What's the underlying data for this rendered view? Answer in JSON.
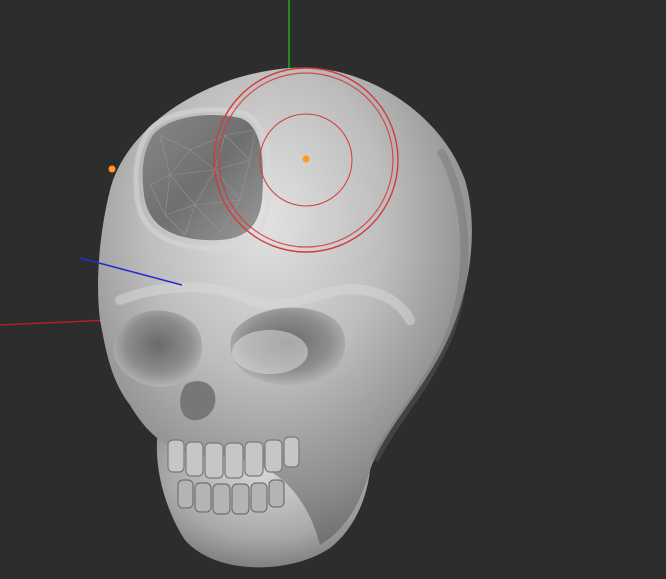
{
  "viewport": {
    "background": "#2d2d2d",
    "model_name": "skull-mesh",
    "tool": "sculpt-brush"
  },
  "colors": {
    "axis_x": "#b22222",
    "axis_y": "#22aa22",
    "axis_z": "#2a2ad0",
    "brush_ring": "#d43a3a",
    "brush_center": "#ff9a1f",
    "gizmo_point": "#ff9a1f",
    "mesh_light": "#d9d9d9",
    "mesh_mid": "#a9a9a9",
    "mesh_dark": "#5f5f5f"
  },
  "icons": [
    "axis-gizmo",
    "brush-cursor",
    "pivot-point"
  ]
}
